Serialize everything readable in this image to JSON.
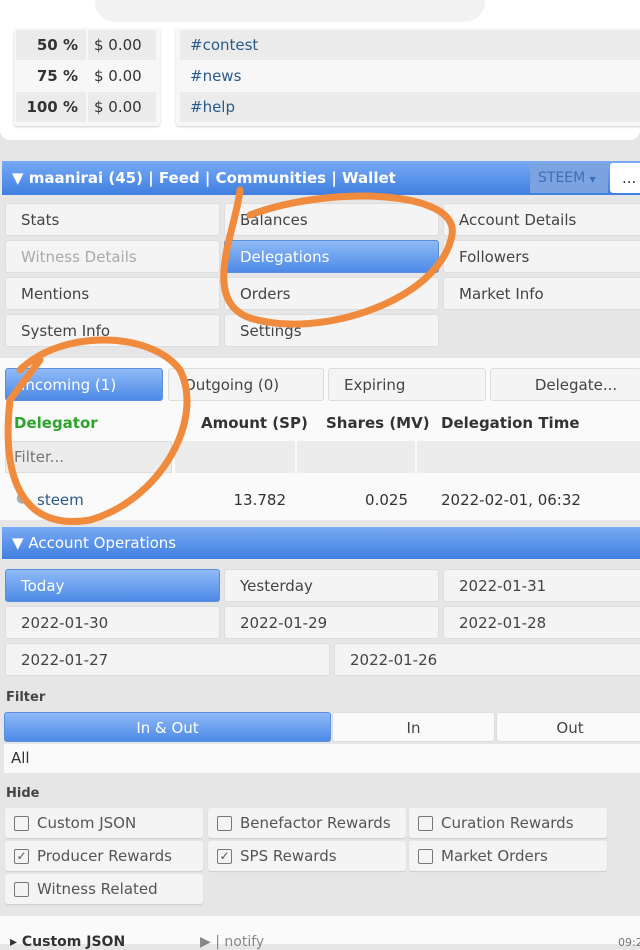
{
  "payout_table": [
    {
      "pct": "50 %",
      "val": "$ 0.00"
    },
    {
      "pct": "75 %",
      "val": "$ 0.00"
    },
    {
      "pct": "100 %",
      "val": "$ 0.00"
    }
  ],
  "tags": [
    "#contest",
    "#news",
    "#help"
  ],
  "navbar": {
    "user": "maanirai (45)",
    "sep": "|",
    "links": [
      "Feed",
      "Communities",
      "Wallet"
    ],
    "chain": "STEEM",
    "more": "..."
  },
  "menu": [
    "Stats",
    "Balances",
    "Account Details",
    "Witness Details",
    "Delegations",
    "Followers",
    "Mentions",
    "Orders",
    "Market Info",
    "System Info",
    "Settings"
  ],
  "delegation_tabs": [
    "Incoming (1)",
    "Outgoing (0)",
    "Expiring",
    "Delegate..."
  ],
  "table": {
    "headers": [
      "Delegator",
      "Amount (SP)",
      "Shares (MV)",
      "Delegation Time"
    ],
    "filter_placeholder": "Filter...",
    "rows": [
      {
        "delegator": "steem",
        "amount": "13.782",
        "shares": "0.025",
        "time": "2022-02-01, 06:32"
      }
    ]
  },
  "account_ops": {
    "title": "Account Operations",
    "dates": [
      "Today",
      "Yesterday",
      "2022-01-31",
      "2022-01-30",
      "2022-01-29",
      "2022-01-28",
      "2022-01-27",
      "2022-01-26"
    ]
  },
  "filter": {
    "label": "Filter",
    "options": [
      "In & Out",
      "In",
      "Out"
    ],
    "select": "All"
  },
  "hide": {
    "label": "Hide",
    "items": [
      {
        "label": "Custom JSON",
        "checked": false
      },
      {
        "label": "Benefactor Rewards",
        "checked": false
      },
      {
        "label": "Curation Rewards",
        "checked": false
      },
      {
        "label": "Producer Rewards",
        "checked": true
      },
      {
        "label": "SPS Rewards",
        "checked": true
      },
      {
        "label": "Market Orders",
        "checked": false
      },
      {
        "label": "Witness Related",
        "checked": false
      }
    ]
  },
  "bottom_row": {
    "type": "Custom JSON",
    "id": "notify",
    "time": "09:2"
  },
  "colors": {
    "accent": "#4d8ae6",
    "delegator_header": "#2aa52a",
    "link": "#2a5a8a",
    "annotation": "#f08a3c"
  }
}
